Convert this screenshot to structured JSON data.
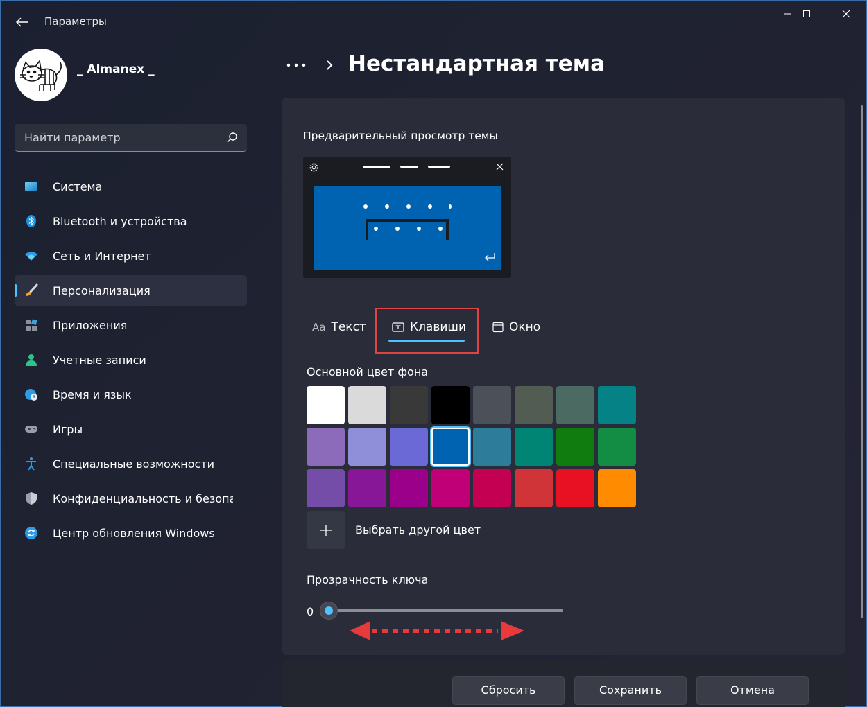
{
  "window": {
    "title": "Параметры",
    "controls": [
      "minimize-icon",
      "maximize-icon",
      "close-icon"
    ]
  },
  "profile": {
    "name": "_ Almanex _"
  },
  "search": {
    "placeholder": "Найти параметр",
    "value": ""
  },
  "sidebar": {
    "items": [
      {
        "label": "Система",
        "icon": "display-icon",
        "active": false
      },
      {
        "label": "Bluetooth и устройства",
        "icon": "bluetooth-icon",
        "active": false
      },
      {
        "label": "Сеть и Интернет",
        "icon": "wifi-icon",
        "active": false
      },
      {
        "label": "Персонализация",
        "icon": "brush-icon",
        "active": true
      },
      {
        "label": "Приложения",
        "icon": "apps-icon",
        "active": false
      },
      {
        "label": "Учетные записи",
        "icon": "person-icon",
        "active": false
      },
      {
        "label": "Время и язык",
        "icon": "globe-clock-icon",
        "active": false
      },
      {
        "label": "Игры",
        "icon": "gamepad-icon",
        "active": false
      },
      {
        "label": "Специальные возможности",
        "icon": "accessibility-icon",
        "active": false
      },
      {
        "label": "Конфиденциальность и безопас",
        "icon": "shield-icon",
        "active": false
      },
      {
        "label": "Центр обновления Windows",
        "icon": "update-icon",
        "active": false
      }
    ]
  },
  "header": {
    "more": "•••",
    "title": "Нестандартная тема"
  },
  "preview": {
    "label": "Предварительный просмотр темы",
    "key_color": "#0063b1"
  },
  "tabs": [
    {
      "label": "Текст",
      "icon": "Aa"
    },
    {
      "label": "Клавиши",
      "icon": "keyboard-icon",
      "selected": true
    },
    {
      "label": "Окно",
      "icon": "window-icon"
    }
  ],
  "background_color": {
    "label": "Основной цвет фона",
    "swatches": [
      "#ffffff",
      "#dadada",
      "#393939",
      "#000000",
      "#4b5059",
      "#535c52",
      "#4b6a62",
      "#058286",
      "#8d6bbb",
      "#8f8fd9",
      "#6b69d6",
      "#0063b1",
      "#2d7d9a",
      "#008575",
      "#107c10",
      "#138d43",
      "#744da9",
      "#881798",
      "#9a0089",
      "#bf0077",
      "#c30052",
      "#d13438",
      "#e81123",
      "#ff8c00"
    ],
    "selected_index": 11,
    "custom_label": "Выбрать другой цвет"
  },
  "key_transparency": {
    "label": "Прозрачность ключа",
    "value": 0,
    "min": 0,
    "max": 100
  },
  "buttons": {
    "reset": "Сбросить",
    "save": "Сохранить",
    "cancel": "Отмена"
  },
  "colors": {
    "accent": "#4cc2ff",
    "highlight_box": "#e04343",
    "annotation_arrow": "#e83a3a"
  }
}
